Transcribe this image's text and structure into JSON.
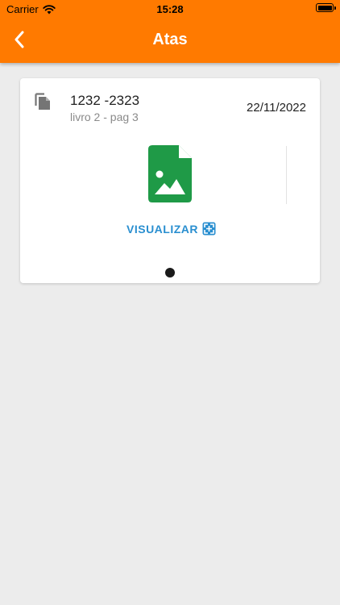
{
  "status_bar": {
    "carrier": "Carrier",
    "time": "15:28",
    "icons": [
      "wifi-icon",
      "battery-icon"
    ]
  },
  "header": {
    "title": "Atas",
    "back_icon": "chevron-left-icon",
    "color": "#ff7a00"
  },
  "record": {
    "number": "1232 -2323",
    "subtitle": "livro 2 - pag 3",
    "date": "22/11/2022",
    "file_icon": "image-file-icon",
    "file_icon_color": "#1f9a47",
    "view_label": "VISUALIZAR",
    "view_color": "#2a8fd0",
    "view_icon": "expand-icon"
  },
  "pager": {
    "current_page": 1,
    "total_pages": 1
  },
  "colors": {
    "background": "#ececec",
    "card": "#ffffff"
  }
}
